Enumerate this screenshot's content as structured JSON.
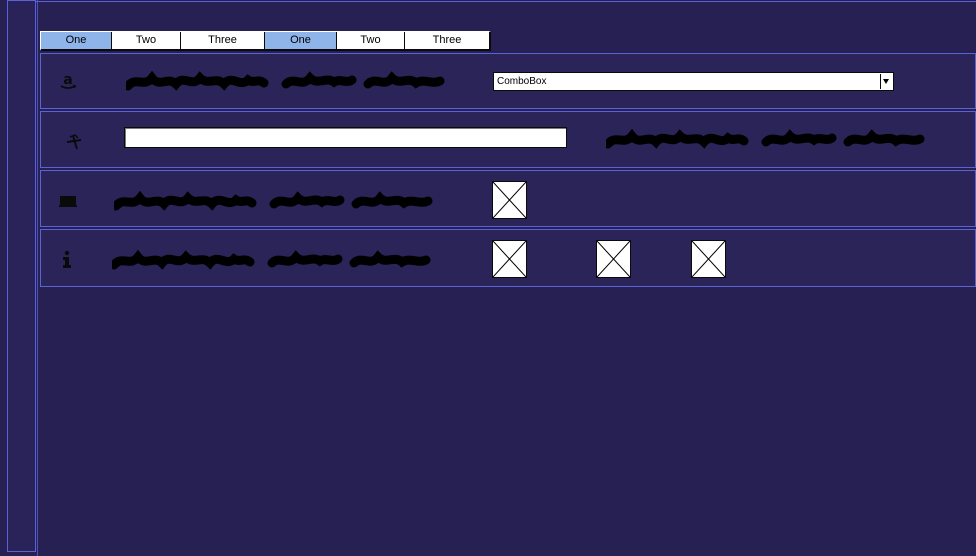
{
  "tabs": [
    {
      "label": "One",
      "active": true
    },
    {
      "label": "Two",
      "active": false
    },
    {
      "label": "Three",
      "active": false
    },
    {
      "label": "One",
      "active": true
    },
    {
      "label": "Two",
      "active": false
    },
    {
      "label": "Three",
      "active": false
    }
  ],
  "rows": [
    {
      "icon": "amazon-icon"
    },
    {
      "icon": "pickaxe-icon",
      "text_input_value": ""
    },
    {
      "icon": "laptop-icon"
    },
    {
      "icon": "info-icon"
    }
  ],
  "combobox": {
    "value": "ComboBox"
  },
  "colors": {
    "background": "#272153",
    "border": "#5b62d6",
    "tab_active": "#8fb4ea",
    "control_bg": "#ffffff"
  }
}
